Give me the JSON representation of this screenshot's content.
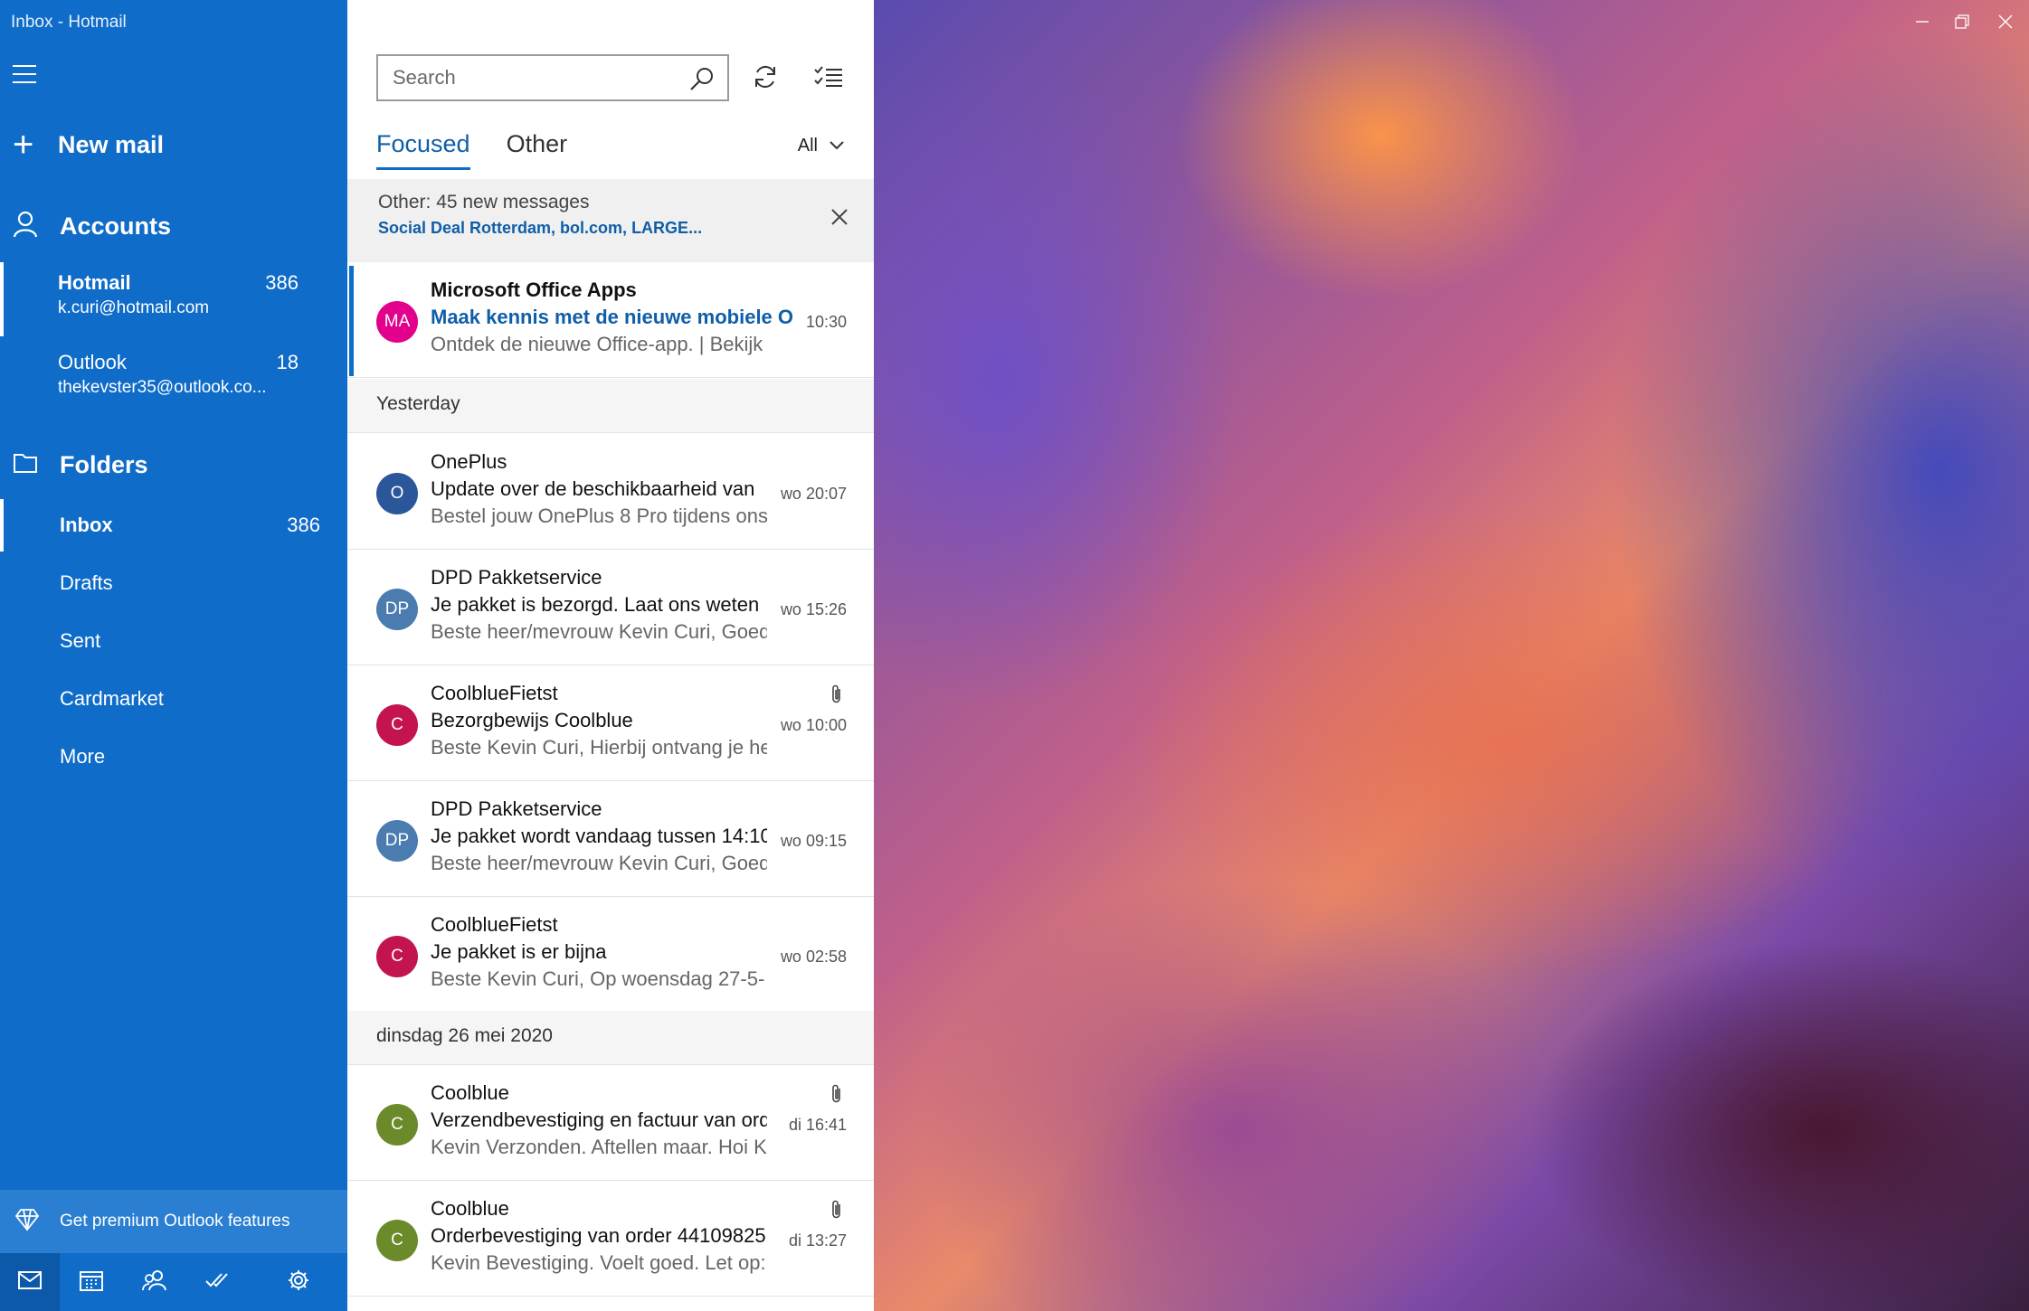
{
  "window": {
    "title": "Inbox - Hotmail"
  },
  "sidebar": {
    "new_mail_label": "New mail",
    "accounts_label": "Accounts",
    "accounts": [
      {
        "name": "Hotmail",
        "email": "k.curi@hotmail.com",
        "count": "386",
        "selected": true
      },
      {
        "name": "Outlook",
        "email": "thekevster35@outlook.co...",
        "count": "18",
        "selected": false
      }
    ],
    "folders_label": "Folders",
    "folders": [
      {
        "label": "Inbox",
        "count": "386",
        "selected": true
      },
      {
        "label": "Drafts",
        "count": ""
      },
      {
        "label": "Sent",
        "count": ""
      },
      {
        "label": "Cardmarket",
        "count": ""
      },
      {
        "label": "More",
        "count": ""
      }
    ],
    "premium_label": "Get premium Outlook features",
    "accent_color": "#0f6cc9"
  },
  "mail_list": {
    "search_placeholder": "Search",
    "tabs": [
      {
        "label": "Focused",
        "active": true
      },
      {
        "label": "Other",
        "active": false
      }
    ],
    "filter_label": "All",
    "other_banner": {
      "title": "Other: 45 new messages",
      "senders": "Social Deal Rotterdam, bol.com, LARGE..."
    },
    "top_messages": [
      {
        "initials": "MA",
        "avatar_color": "#e3008c",
        "sender": "Microsoft Office Apps",
        "subject": "Maak kennis met de nieuwe mobiele Office-app",
        "preview": "Ontdek de nieuwe Office-app. | Bekijk 'm",
        "time": "10:30",
        "attachment": false,
        "selected": true
      }
    ],
    "groups": [
      {
        "label": "Yesterday",
        "messages": [
          {
            "initials": "O",
            "avatar_color": "#2b579a",
            "sender": "OnePlus",
            "subject": "Update over de beschikbaarheid van",
            "preview": "Bestel jouw OnePlus 8 Pro tijdens ons",
            "time": "wo 20:07",
            "attachment": false
          },
          {
            "initials": "DP",
            "avatar_color": "#4a7cb0",
            "sender": "DPD Pakketservice",
            "subject": "Je pakket is bezorgd. Laat ons weten",
            "preview": "Beste heer/mevrouw Kevin Curi, Goed",
            "time": "wo 15:26",
            "attachment": false
          },
          {
            "initials": "C",
            "avatar_color": "#c4144f",
            "sender": "CoolblueFietst",
            "subject": "Bezorgbewijs Coolblue",
            "preview": "Beste Kevin Curi, Hierbij ontvang je het",
            "time": "wo 10:00",
            "attachment": true
          },
          {
            "initials": "DP",
            "avatar_color": "#4a7cb0",
            "sender": "DPD Pakketservice",
            "subject": "Je pakket wordt vandaag tussen 14:10",
            "preview": "Beste heer/mevrouw Kevin Curi, Goed",
            "time": "wo 09:15",
            "attachment": false
          },
          {
            "initials": "C",
            "avatar_color": "#c4144f",
            "sender": "CoolblueFietst",
            "subject": "Je pakket is er bijna",
            "preview": "Beste Kevin Curi, Op woensdag 27-5-",
            "time": "wo 02:58",
            "attachment": false
          }
        ]
      },
      {
        "label": "dinsdag 26 mei 2020",
        "messages": [
          {
            "initials": "C",
            "avatar_color": "#6b8a2a",
            "sender": "Coolblue",
            "subject": "Verzendbevestiging en factuur van order",
            "preview": "Kevin Verzonden. Aftellen maar. Hoi Kevin",
            "time": "di 16:41",
            "attachment": true
          },
          {
            "initials": "C",
            "avatar_color": "#6b8a2a",
            "sender": "Coolblue",
            "subject": "Orderbevestiging van order 44109825",
            "preview": "Kevin Bevestiging. Voelt goed. Let op:",
            "time": "di 13:27",
            "attachment": true
          }
        ]
      }
    ]
  }
}
